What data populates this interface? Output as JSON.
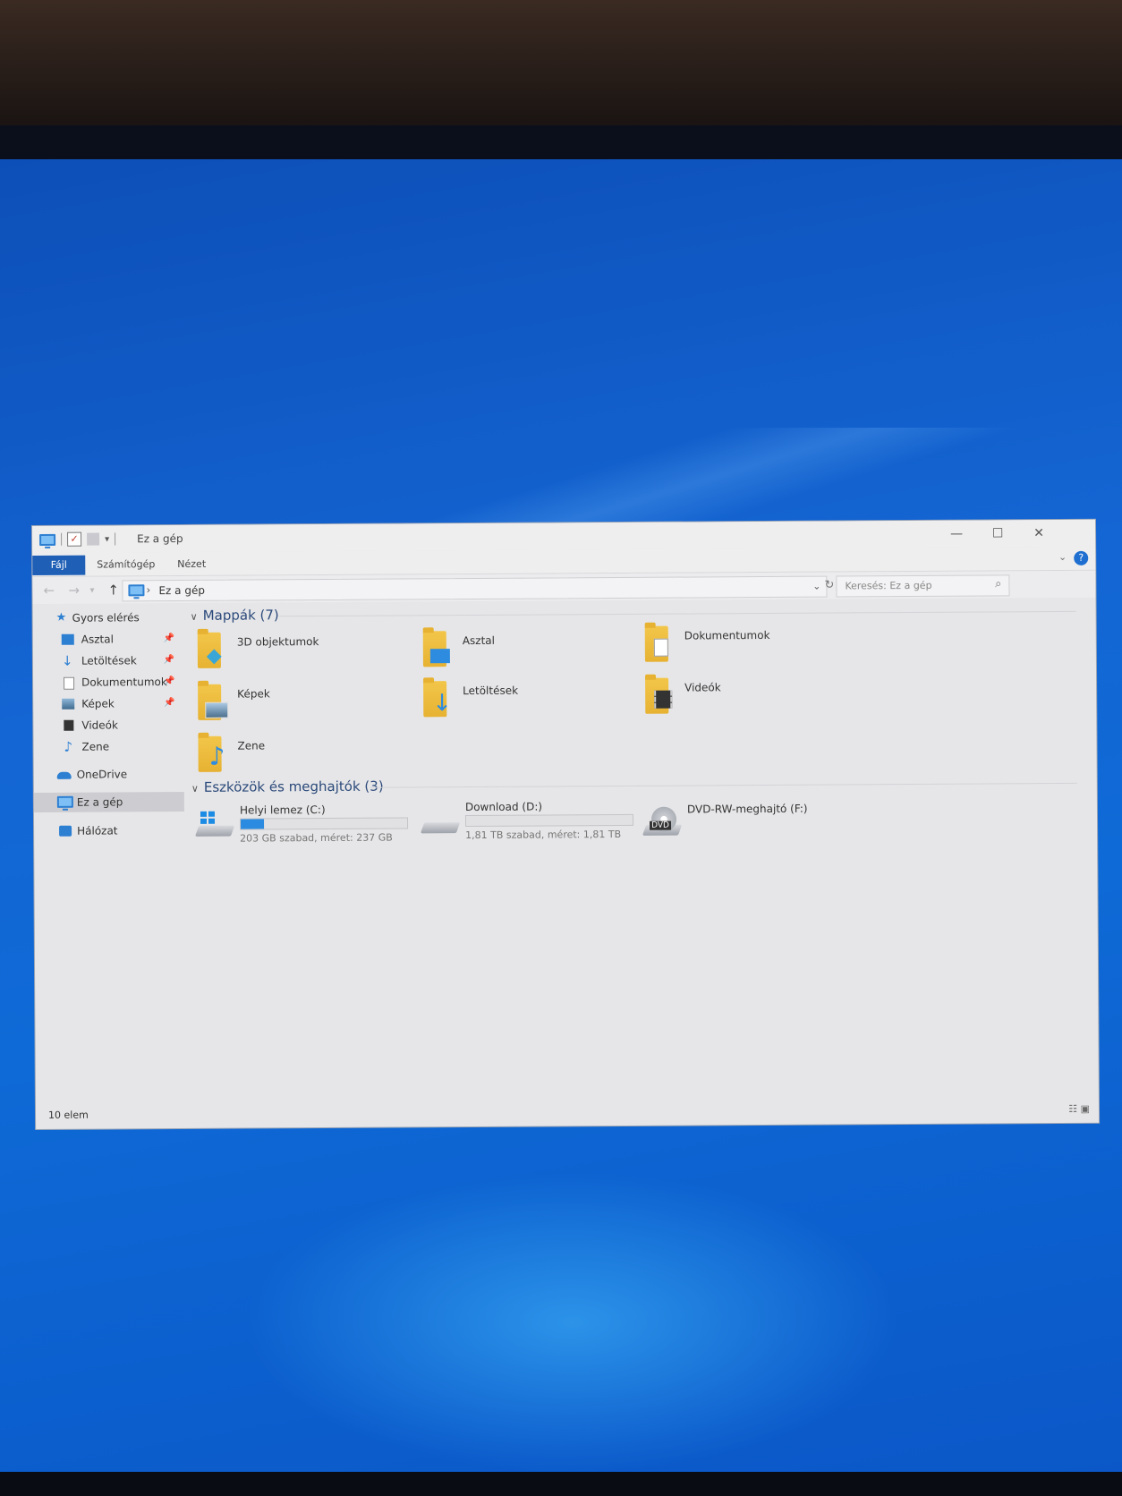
{
  "window": {
    "title": "Ez a gép",
    "controls": {
      "minimize": "—",
      "maximize": "☐",
      "close": "✕"
    }
  },
  "ribbon": {
    "tabs": [
      {
        "label": "Fájl"
      },
      {
        "label": "Számítógép"
      },
      {
        "label": "Nézet"
      }
    ],
    "help": "?"
  },
  "address": {
    "crumb": "Ez a gép",
    "search_placeholder": "Keresés: Ez a gép"
  },
  "sidebar": {
    "items": [
      {
        "label": "Gyors elérés",
        "icon": "star-icon"
      },
      {
        "label": "Asztal",
        "icon": "desktop-icon",
        "pinned": true
      },
      {
        "label": "Letöltések",
        "icon": "download-icon",
        "pinned": true
      },
      {
        "label": "Dokumentumok",
        "icon": "documents-icon",
        "pinned": true
      },
      {
        "label": "Képek",
        "icon": "pictures-icon",
        "pinned": true
      },
      {
        "label": "Videók",
        "icon": "videos-icon"
      },
      {
        "label": "Zene",
        "icon": "music-icon"
      },
      {
        "label": "OneDrive",
        "icon": "cloud-icon"
      },
      {
        "label": "Ez a gép",
        "icon": "computer-icon",
        "selected": true
      },
      {
        "label": "Hálózat",
        "icon": "network-icon"
      }
    ]
  },
  "folders": {
    "header": "Mappák (7)",
    "items": [
      {
        "label": "3D objektumok",
        "icon": "3d-objects-folder-icon"
      },
      {
        "label": "Asztal",
        "icon": "desktop-folder-icon"
      },
      {
        "label": "Dokumentumok",
        "icon": "documents-folder-icon"
      },
      {
        "label": "Képek",
        "icon": "pictures-folder-icon"
      },
      {
        "label": "Letöltések",
        "icon": "downloads-folder-icon"
      },
      {
        "label": "Videók",
        "icon": "videos-folder-icon"
      },
      {
        "label": "Zene",
        "icon": "music-folder-icon"
      }
    ]
  },
  "drives": {
    "header": "Eszközök és meghajtók (3)",
    "items": [
      {
        "name": "Helyi lemez (C:)",
        "info": "203 GB szabad, méret: 237 GB",
        "used_fraction": 0.14,
        "icon": "system-drive-icon"
      },
      {
        "name": "Download (D:)",
        "info": "1,81 TB szabad, méret: 1,81 TB",
        "used_fraction": 0.0,
        "icon": "hard-drive-icon"
      },
      {
        "name": "DVD-RW-meghajtó (F:)",
        "icon": "dvd-drive-icon",
        "tag": "DVD"
      }
    ]
  },
  "status": {
    "count": "10 elem"
  },
  "colors": {
    "accent": "#1f5fb6",
    "bar_fill": "#2a8be0",
    "folder": "#e7b232"
  }
}
